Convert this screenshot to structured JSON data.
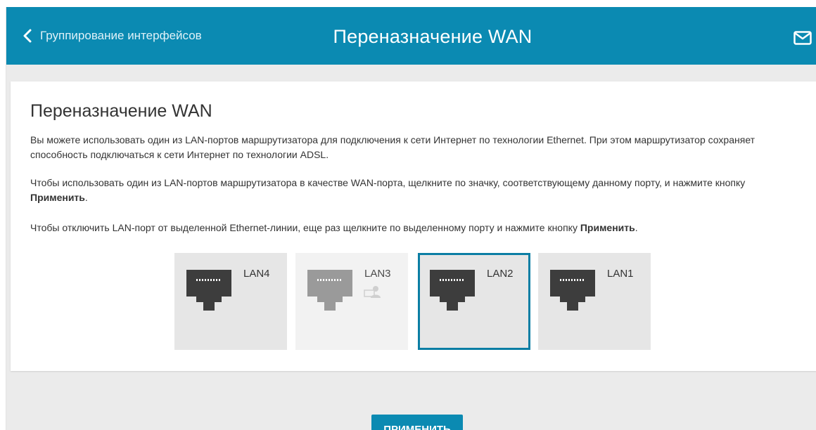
{
  "header": {
    "back_label": "Группирование интерфейсов",
    "title": "Переназначение WAN"
  },
  "section": {
    "title": "Переназначение WAN",
    "para1": "Вы можете использовать один из LAN-портов маршрутизатора для подключения к сети Интернет по технологии Ethernet. При этом маршрутизатор сохраняет способность подключаться к сети Интернет по технологии ADSL.",
    "para2_text": "Чтобы использовать один из LAN-портов маршрутизатора в качестве WAN-порта, щелкните по значку, соответствующему данному порту, и нажмите кнопку ",
    "para2_bold": "Применить",
    "para2_end": ".",
    "para3_text": "Чтобы отключить LAN-порт от выделенной Ethernet-линии, еще раз щелкните по выделенному порту и нажмите кнопку ",
    "para3_bold": "Применить",
    "para3_end": "."
  },
  "ports": [
    {
      "label": "LAN4",
      "state": "normal"
    },
    {
      "label": "LAN3",
      "state": "disabled",
      "icon": "user-device-icon"
    },
    {
      "label": "LAN2",
      "state": "selected"
    },
    {
      "label": "LAN1",
      "state": "normal"
    }
  ],
  "apply_label": "ПРИМЕНИТЬ",
  "colors": {
    "accent": "#0b8ab2",
    "selected_border": "#0b7ea4",
    "background": "#ebebeb"
  }
}
